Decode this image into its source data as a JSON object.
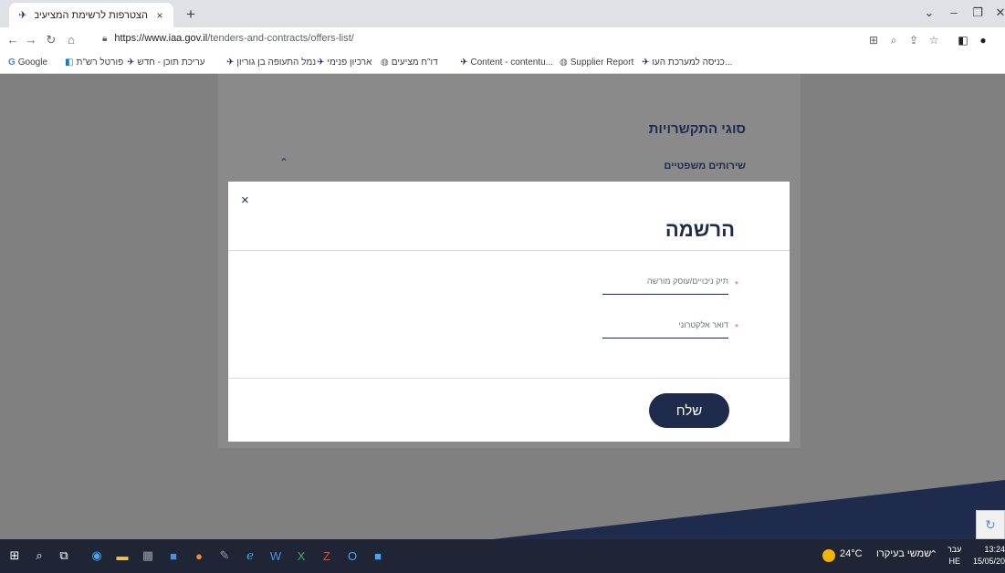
{
  "browser": {
    "tab_title": "הצטרפות לרשימת המציעים",
    "tab_close": "×",
    "new_tab": "+",
    "url_host": "https://www.iaa.gov.il",
    "url_path": "/tenders-and-contracts/offers-list/",
    "bookmarks": [
      "Google",
      "פורטל רש\"ת",
      "עריכת תוכן - חדש",
      "נמל התעופה בן גוריון",
      "ארכיון פנימי",
      "דו\"ח מציעים",
      "Content - contentu...",
      "Supplier Report",
      "כניסה למערכת העו..."
    ]
  },
  "page": {
    "section_title": "סוגי התקשרויות",
    "sub_title": "שירותים משפטיים"
  },
  "modal": {
    "title": "הרשמה",
    "close_glyph": "×",
    "field1_label": "תיק ניכויים/עוסק מורשה",
    "field2_label": "דואר אלקטרוני",
    "required_mark": "*",
    "submit_label": "שלח"
  },
  "taskbar": {
    "temperature": "24°C",
    "weather_text": "שמשי בעיקרו",
    "lang_line1": "עבר",
    "lang_line2": "HE",
    "time": "13:24",
    "date": "15/05/20"
  },
  "colors": {
    "brand_navy": "#1e2b4c",
    "overlay_gray": "#808080",
    "required_red": "#e05555"
  }
}
